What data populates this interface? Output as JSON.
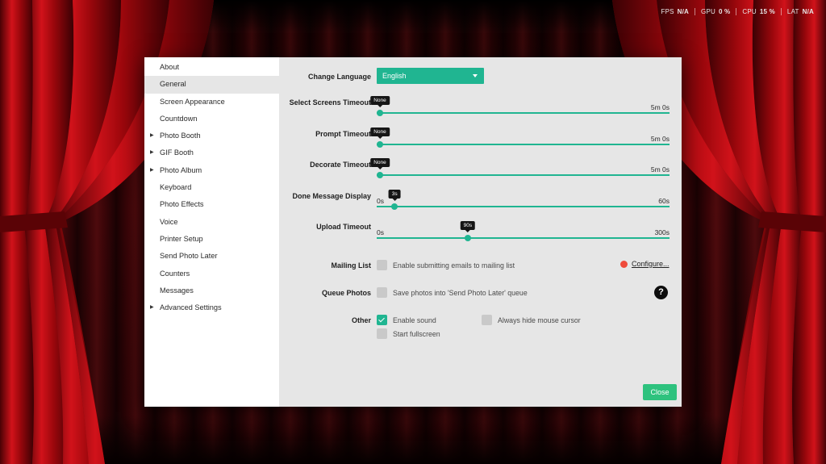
{
  "stats": [
    {
      "label": "FPS",
      "value": "N/A"
    },
    {
      "label": "GPU",
      "value": "0 %"
    },
    {
      "label": "CPU",
      "value": "15 %"
    },
    {
      "label": "LAT",
      "value": "N/A"
    }
  ],
  "sidebar": {
    "items": [
      {
        "label": "About",
        "expandable": false,
        "active": false
      },
      {
        "label": "General",
        "expandable": false,
        "active": true
      },
      {
        "label": "Screen Appearance",
        "expandable": false,
        "active": false
      },
      {
        "label": "Countdown",
        "expandable": false,
        "active": false
      },
      {
        "label": "Photo Booth",
        "expandable": true,
        "active": false
      },
      {
        "label": "GIF Booth",
        "expandable": true,
        "active": false
      },
      {
        "label": "Photo Album",
        "expandable": true,
        "active": false
      },
      {
        "label": "Keyboard",
        "expandable": false,
        "active": false
      },
      {
        "label": "Photo Effects",
        "expandable": false,
        "active": false
      },
      {
        "label": "Voice",
        "expandable": false,
        "active": false
      },
      {
        "label": "Printer Setup",
        "expandable": false,
        "active": false
      },
      {
        "label": "Send Photo Later",
        "expandable": false,
        "active": false
      },
      {
        "label": "Counters",
        "expandable": false,
        "active": false
      },
      {
        "label": "Messages",
        "expandable": false,
        "active": false
      },
      {
        "label": "Advanced Settings",
        "expandable": true,
        "active": false
      }
    ],
    "caret_glyph": "▶"
  },
  "general": {
    "language": {
      "label": "Change Language",
      "value": "English"
    },
    "select_screens_timeout": {
      "label": "Select Screens Timeout",
      "value_label": "None",
      "min": "",
      "max": "5m 0s",
      "fraction": 0.0
    },
    "prompt_timeout": {
      "label": "Prompt Timeout",
      "value_label": "None",
      "min": "",
      "max": "5m 0s",
      "fraction": 0.0
    },
    "decorate_timeout": {
      "label": "Decorate Timeout",
      "value_label": "None",
      "min": "",
      "max": "5m 0s",
      "fraction": 0.0
    },
    "done_message_display": {
      "label": "Done Message Display",
      "value_label": "3s",
      "min": "0s",
      "max": "60s",
      "fraction": 0.05
    },
    "upload_timeout": {
      "label": "Upload Timeout",
      "value_label": "90s",
      "min": "0s",
      "max": "300s",
      "fraction": 0.3
    },
    "mailing_list": {
      "label": "Mailing List",
      "option": "Enable submitting emails to mailing list",
      "checked": false,
      "configure": "Configure..."
    },
    "queue_photos": {
      "label": "Queue Photos",
      "option": "Save photos into 'Send Photo Later' queue",
      "checked": false,
      "help": "?"
    },
    "other": {
      "label": "Other",
      "enable_sound": {
        "label": "Enable sound",
        "checked": true
      },
      "always_hide_cursor": {
        "label": "Always hide mouse cursor",
        "checked": false
      },
      "start_fullscreen": {
        "label": "Start fullscreen",
        "checked": false
      }
    }
  },
  "close_label": "Close",
  "colors": {
    "accent": "#20b591",
    "close_button": "#2ec27e",
    "status_dot": "#ef4b3b",
    "curtain": "#b10a0f"
  },
  "icons": {
    "dropdown": "chevron-down-icon",
    "help": "question-circle-icon",
    "check": "checkmark-icon",
    "status": "status-dot-icon"
  }
}
